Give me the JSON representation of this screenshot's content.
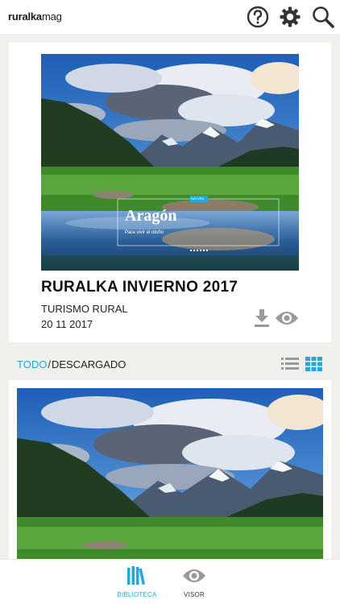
{
  "app": {
    "logo_part1": "ruralka",
    "logo_part2": "mag"
  },
  "header": {
    "icons": [
      "help-icon",
      "gear-icon",
      "search-icon"
    ]
  },
  "featured": {
    "cover_title": "Aragón",
    "cover_subtitle": "Para vivir el otoño",
    "cover_tag": "NATURA",
    "title": "RURALKA INVIERNO 2017",
    "category": "TURISMO RURAL",
    "date": "20 11 2017"
  },
  "filter": {
    "all_label": "TODO",
    "separator": "/",
    "downloaded_label": "DESCARGADO",
    "active": "TODO"
  },
  "bottom_nav": {
    "tabs": [
      {
        "label": "BIBLIOTECA",
        "icon": "books-icon",
        "active": true
      },
      {
        "label": "VISOR",
        "icon": "eye-icon",
        "active": false
      }
    ]
  },
  "colors": {
    "accent": "#24a8d8",
    "icon_gray": "#9a9a9a",
    "header_icon": "#333333",
    "background": "#f1f0ec"
  }
}
